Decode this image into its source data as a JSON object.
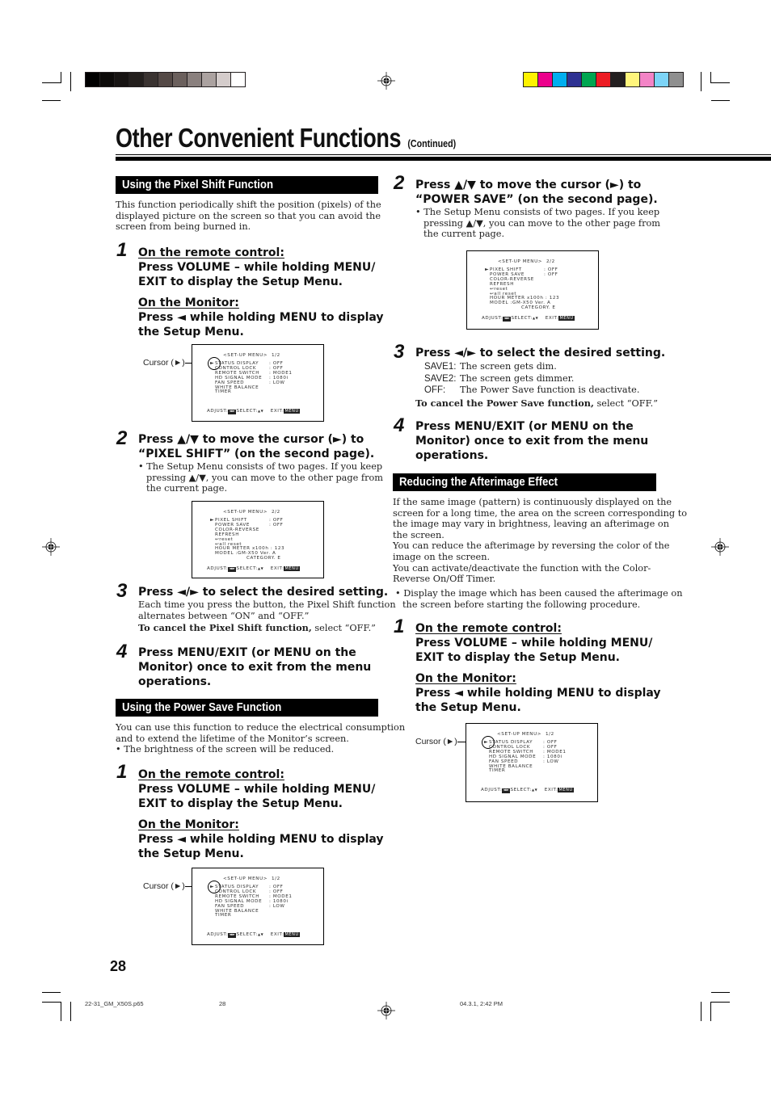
{
  "header": {
    "title": "Other Convenient Functions",
    "continued": "(Continued)",
    "grayscale_bar": [
      "#000000",
      "#0c0a09",
      "#171413",
      "#231f1d",
      "#3a3331",
      "#544946",
      "#6b605d",
      "#8a807e",
      "#aba2a0",
      "#d4cccb",
      "#ffffff"
    ],
    "color_bar": [
      "#fff200",
      "#ec008c",
      "#00aeef",
      "#2e3192",
      "#00a651",
      "#ed1c24",
      "#231f20",
      "#fff57c",
      "#f384c6",
      "#7dd4f7",
      "#8f8f8f"
    ]
  },
  "pixel_shift": {
    "section_title": "Using the Pixel Shift Function",
    "intro": [
      "This function periodically shift the position (pixels) of the",
      "displayed picture on the screen so that you can avoid the",
      "screen from being burned in."
    ],
    "step1": {
      "num": "1",
      "remote_label": "On the remote control:",
      "remote_text": [
        "Press VOLUME – while holding MENU/",
        "EXIT to display the Setup Menu."
      ],
      "monitor_label": "On the Monitor:",
      "monitor_text": [
        "Press ◄ while holding MENU to display",
        "the Setup Menu."
      ]
    },
    "step2": {
      "num": "2",
      "text": [
        "Press ▲/▼ to move the cursor (►) to",
        "“PIXEL SHIFT” (on the second page)."
      ],
      "note": [
        "• The Setup Menu consists of two pages. If you keep",
        "pressing ▲/▼, you can move to the other page from",
        "the current page."
      ]
    },
    "step3": {
      "num": "3",
      "text": "Press ◄/► to select the desired setting.",
      "body": [
        "Each time you press the button, the Pixel Shift function",
        "alternates between “ON” and “OFF.”"
      ],
      "cancel_bold": "To cancel the Pixel Shift function,",
      "cancel_rest": " select “OFF.”"
    },
    "step4": {
      "num": "4",
      "text": [
        "Press MENU/EXIT (or MENU on the",
        "Monitor) once to exit from the menu",
        "operations."
      ]
    }
  },
  "power_save": {
    "section_title": "Using the Power Save Function",
    "intro": [
      "You can use this function to reduce the electrical consumption",
      "and to extend the lifetime of the Monitor’s screen.",
      "• The brightness of the screen will be reduced."
    ],
    "step1": {
      "num": "1",
      "remote_label": "On the remote control:",
      "remote_text": [
        "Press VOLUME – while holding MENU/",
        "EXIT to display the Setup Menu."
      ],
      "monitor_label": "On the Monitor:",
      "monitor_text": [
        "Press ◄ while holding MENU to display",
        "the Setup Menu."
      ]
    },
    "step2": {
      "num": "2",
      "text": [
        "Press ▲/▼ to move the cursor (►) to",
        "“POWER SAVE” (on the second page)."
      ],
      "note": [
        "• The Setup Menu consists of two pages. If you keep",
        "pressing ▲/▼, you can move to the other page from",
        "the current page."
      ]
    },
    "step3": {
      "num": "3",
      "text": "Press ◄/► to select the desired setting.",
      "options": [
        {
          "key": "SAVE1:",
          "desc": "The screen gets dim."
        },
        {
          "key": "SAVE2:",
          "desc": "The screen gets dimmer."
        },
        {
          "key": "OFF:",
          "desc": "The Power Save function is deactivate."
        }
      ],
      "cancel_bold": "To cancel the Power Save function,",
      "cancel_rest": " select “OFF.”"
    },
    "step4": {
      "num": "4",
      "text": [
        "Press MENU/EXIT (or MENU on the",
        "Monitor) once to exit from the menu",
        "operations."
      ]
    }
  },
  "afterimage": {
    "section_title": "Reducing the Afterimage Effect",
    "intro": [
      "If the same image (pattern) is continuously displayed on the",
      "screen for a long time, the area on the screen corresponding to",
      "the image may vary in brightness, leaving an afterimage on",
      "the screen.",
      "You can reduce the afterimage by reversing the color of the",
      "image on the screen.",
      "You can activate/deactivate the function with the Color-",
      "Reverse On/Off Timer."
    ],
    "note": [
      "• Display the image which has been caused the afterimage on",
      "the screen before starting the following procedure."
    ],
    "step1": {
      "num": "1",
      "remote_label": "On the remote control:",
      "remote_text": [
        "Press VOLUME – while holding MENU/",
        "EXIT to display the Setup Menu."
      ],
      "monitor_label": "On the Monitor:",
      "monitor_text": [
        "Press ◄ while holding MENU to display",
        "the Setup Menu."
      ]
    }
  },
  "osd_page1": {
    "title": "<SET-UP MENU>",
    "page": "1/2",
    "items": [
      {
        "label": "STATUS DISPLAY",
        "value": ": OFF"
      },
      {
        "label": "CONTROL LOCK",
        "value": ": OFF"
      },
      {
        "label": "REMOTE SWITCH",
        "value": ": MODE1"
      },
      {
        "label": "HD SIGNAL MODE",
        "value": ": 1080i"
      },
      {
        "label": "FAN SPEED",
        "value": ": LOW"
      },
      {
        "label": "WHITE BALANCE",
        "value": ""
      },
      {
        "label": "TIMER",
        "value": ""
      }
    ],
    "footer_adjust": "ADJUST:",
    "footer_select": "SELECT:",
    "footer_exit": "EXIT:",
    "menu_btn": "MENU",
    "cursor_label": "Cursor (►)"
  },
  "osd_page2": {
    "title": "<SET-UP MENU>",
    "page": "2/2",
    "items": [
      {
        "label": "PIXEL SHIFT",
        "value": ": OFF"
      },
      {
        "label": "POWER SAVE",
        "value": ": OFF"
      },
      {
        "label": "COLOR-REVERSE",
        "value": ""
      },
      {
        "label": "REFRESH",
        "value": ""
      },
      {
        "label": "↩reset",
        "value": ""
      },
      {
        "label": "↩all reset",
        "value": ""
      },
      {
        "label": "HOUR METER x100h : 123",
        "value": ""
      },
      {
        "label": "MODEL  :GM-X50    Ver. A",
        "value": ""
      },
      {
        "label": "CATEGORY. E",
        "value": ""
      }
    ],
    "footer_adjust": "ADJUST:",
    "footer_select": "SELECT:",
    "footer_exit": "EXIT:",
    "menu_btn": "MENU"
  },
  "footer": {
    "page_number": "28",
    "file_name": "22-31_GM_X50S.p65",
    "file_page": "28",
    "timestamp": "04.3.1, 2:42 PM"
  }
}
